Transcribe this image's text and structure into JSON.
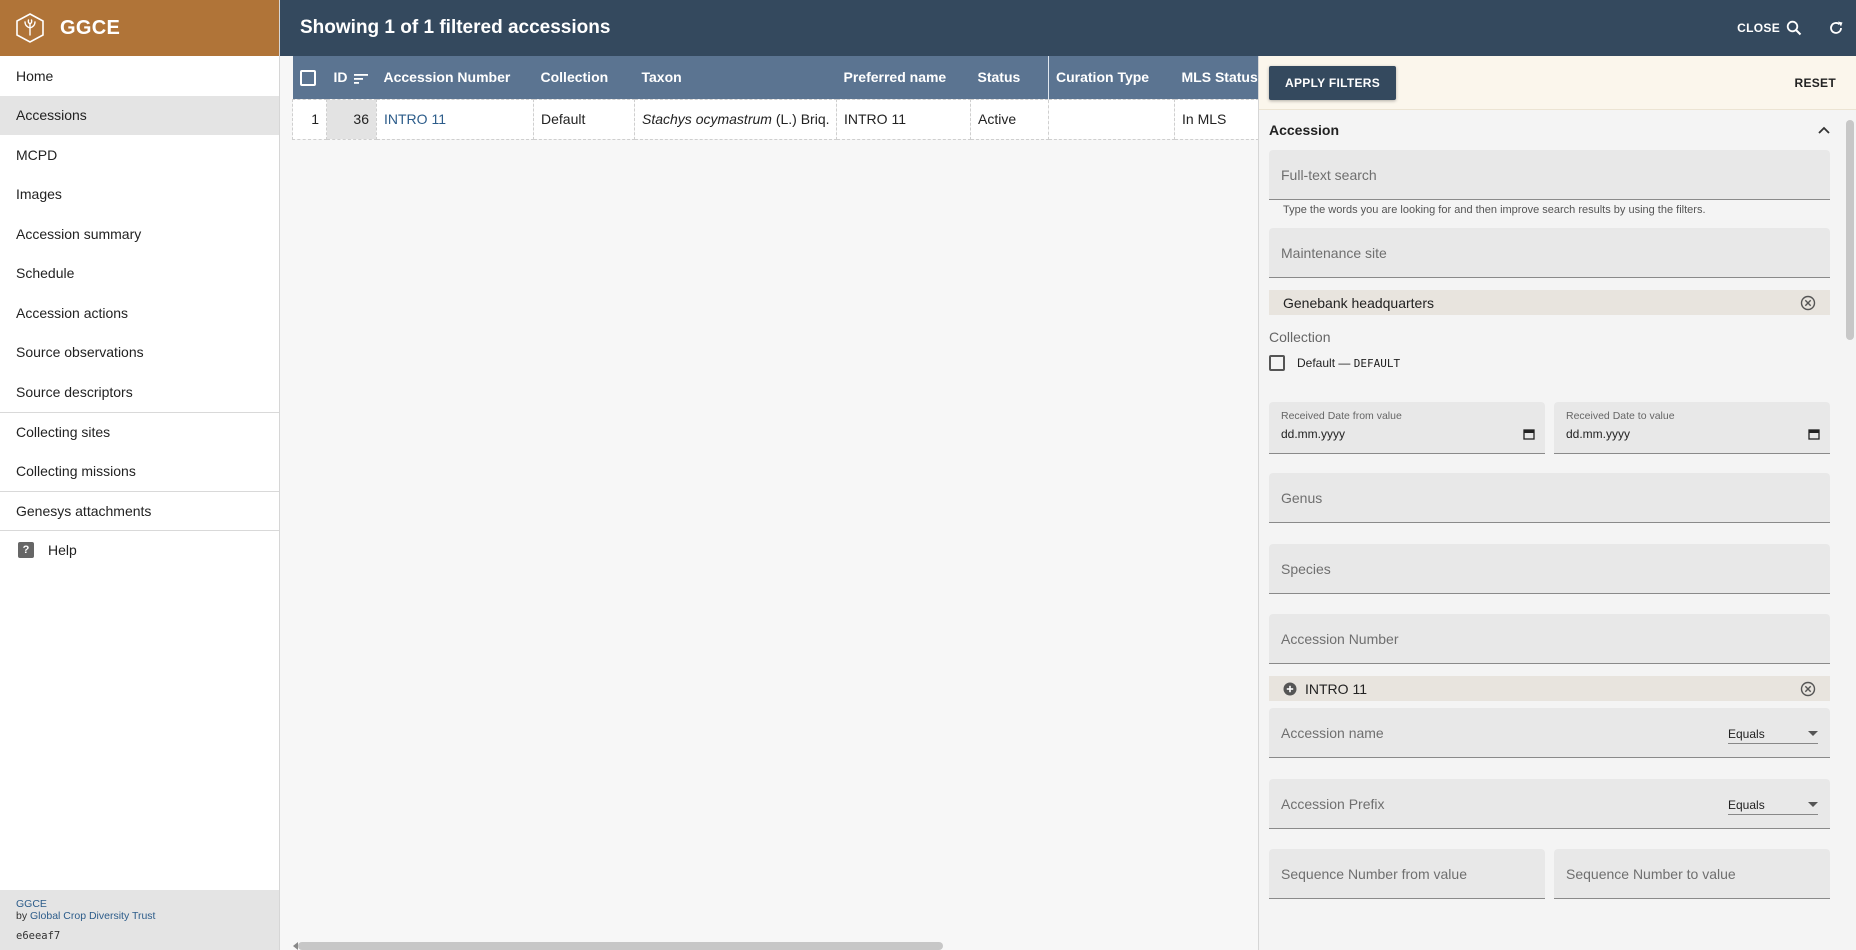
{
  "app": {
    "name": "GGCE"
  },
  "sidebar": {
    "items": [
      {
        "label": "Home"
      },
      {
        "label": "Accessions"
      },
      {
        "label": "MCPD"
      },
      {
        "label": "Images"
      },
      {
        "label": "Accession summary"
      },
      {
        "label": "Schedule"
      },
      {
        "label": "Accession actions"
      },
      {
        "label": "Source observations"
      },
      {
        "label": "Source descriptors"
      },
      {
        "label": "Collecting sites"
      },
      {
        "label": "Collecting missions"
      },
      {
        "label": "Genesys attachments"
      },
      {
        "label": "Help"
      }
    ],
    "footer": {
      "app": "GGCE",
      "by": "by",
      "org": "Global Crop Diversity Trust",
      "hash": "e6eeaf7"
    }
  },
  "topbar": {
    "title": "Showing 1 of 1 filtered accessions",
    "close_label": "CLOSE"
  },
  "table": {
    "columns": [
      "ID",
      "Accession Number",
      "Collection",
      "Taxon",
      "Preferred name",
      "Status",
      "Curation Type",
      "MLS Status"
    ],
    "rows": [
      {
        "index": "1",
        "id": "36",
        "accession_number": "INTRO 11",
        "collection": "Default",
        "taxon_genus_species": "Stachys ocymastrum",
        "taxon_author": "(L.) Briq.",
        "preferred_name": "INTRO 11",
        "status": "Active",
        "curation_type": "",
        "mls_status": "In MLS"
      }
    ]
  },
  "filters": {
    "apply_label": "APPLY FILTERS",
    "reset_label": "RESET",
    "section_title": "Accession",
    "fulltext": {
      "placeholder": "Full-text search",
      "helper": "Type the words you are looking for and then improve search results by using the filters."
    },
    "maintenance_site": {
      "placeholder": "Maintenance site",
      "chip": "Genebank headquarters"
    },
    "collection": {
      "label": "Collection",
      "option_name": "Default",
      "option_dash": "—",
      "option_code": "DEFAULT"
    },
    "received_from": {
      "label": "Received Date from value",
      "value": "dd.mm.yyyy"
    },
    "received_to": {
      "label": "Received Date to value",
      "value": "dd.mm.yyyy"
    },
    "genus": {
      "placeholder": "Genus"
    },
    "species": {
      "placeholder": "Species"
    },
    "accession_number": {
      "placeholder": "Accession Number",
      "chip": "INTRO 11"
    },
    "accession_name": {
      "placeholder": "Accession name",
      "operator": "Equals"
    },
    "accession_prefix": {
      "placeholder": "Accession Prefix",
      "operator": "Equals"
    },
    "sequence_from": {
      "placeholder": "Sequence Number from value"
    },
    "sequence_to": {
      "placeholder": "Sequence Number to value"
    }
  },
  "colors": {
    "brand": "#b07438",
    "topbar": "#34495e",
    "table_header": "#5b7491",
    "link": "#2c5c8a"
  }
}
